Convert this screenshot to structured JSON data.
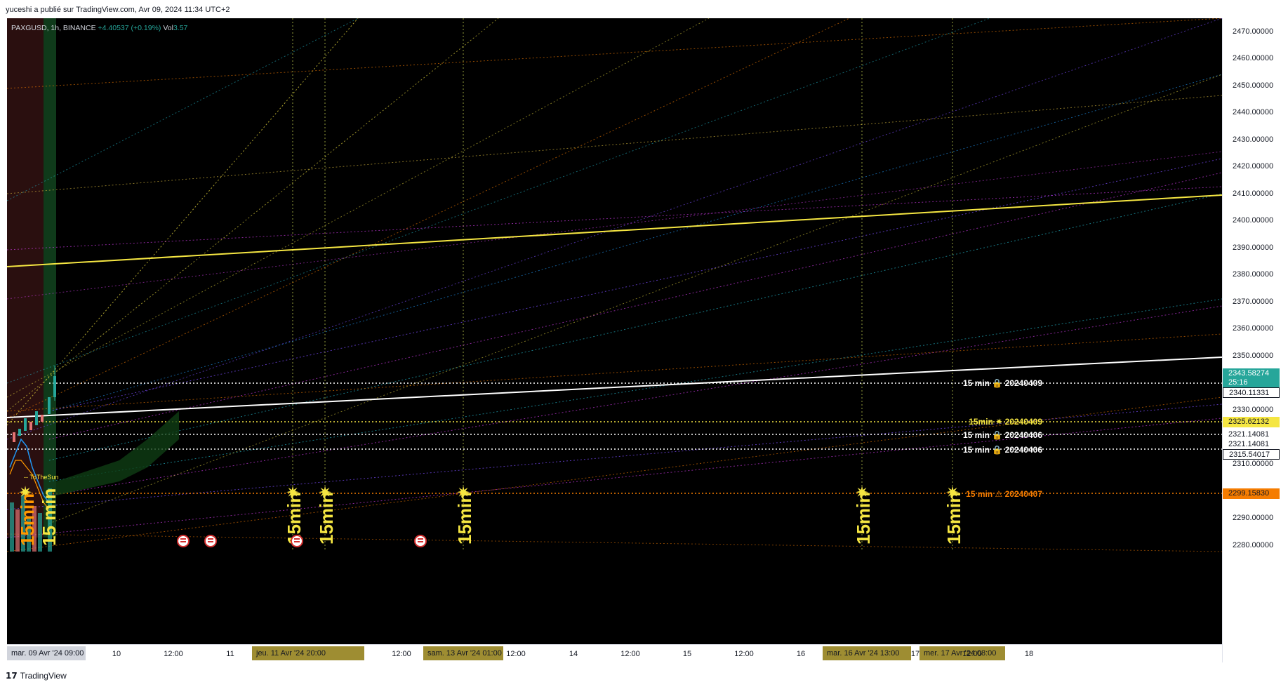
{
  "header": {
    "published": "yuceshi a publié sur TradingView.com, Avr 09, 2024 11:34 UTC+2"
  },
  "legend": {
    "symbol": "PAXGUSD, 1h, BINANCE",
    "change": "+4.40537 (+0.19%)",
    "vol_label": "Vol",
    "vol_value": "3.57"
  },
  "price_axis": {
    "ticks": [
      "2470.00000",
      "2460.00000",
      "2450.00000",
      "2440.00000",
      "2430.00000",
      "2420.00000",
      "2410.00000",
      "2400.00000",
      "2390.00000",
      "2380.00000",
      "2370.00000",
      "2360.00000",
      "2350.00000",
      "2330.00000",
      "2310.00000",
      "2290.00000",
      "2280.00000"
    ],
    "labels": {
      "last_price": "2343.58274",
      "countdown": "25:16",
      "l2": "2340.11331",
      "l3": "2325.62132",
      "l4": "2321.14081",
      "l5": "2321.14081",
      "l6": "2315.54017",
      "l7": "2299.15830"
    }
  },
  "lines": {
    "r1": {
      "tf": "15 min",
      "date": "20240409"
    },
    "r2": {
      "tf": "15min",
      "date": "20240409"
    },
    "r3": {
      "tf": "15 min",
      "date": "20240406"
    },
    "r4": {
      "tf": "15 min",
      "date": "20240406"
    },
    "r5": {
      "tf": "15 min",
      "date": "20240407"
    }
  },
  "vertical_labels": {
    "v1": "15min",
    "v2": "15min",
    "v3": "15min",
    "v4": "15min",
    "v5": "15min",
    "v6": "15 min",
    "v7": "15min"
  },
  "indicator_labels": {
    "tothesun": "-- ToTheSun"
  },
  "time_axis": {
    "start_box": "mar. 09 Avr '24   09:00",
    "ticks": [
      "10",
      "12:00",
      "11",
      "12:00",
      "14",
      "12:00",
      "15",
      "12:00",
      "16",
      "18"
    ],
    "box_thu": "jeu. 11 Avr '24   20:00",
    "box_sat": "sam. 13 Avr '24   01:00",
    "tick_1200b": "12:00",
    "box_tue": "mar. 16 Avr '24   13:00",
    "box_wed": "mer. 17 Avr '24   08:00",
    "tick_17": "17",
    "tick_1200c": "12:00"
  },
  "footer": {
    "logo_mark": "17",
    "brand": "TradingView"
  },
  "colors": {
    "yellow": "#f5e642",
    "orange": "#f57c00",
    "white": "#ffffff",
    "teal": "#26a69a"
  }
}
